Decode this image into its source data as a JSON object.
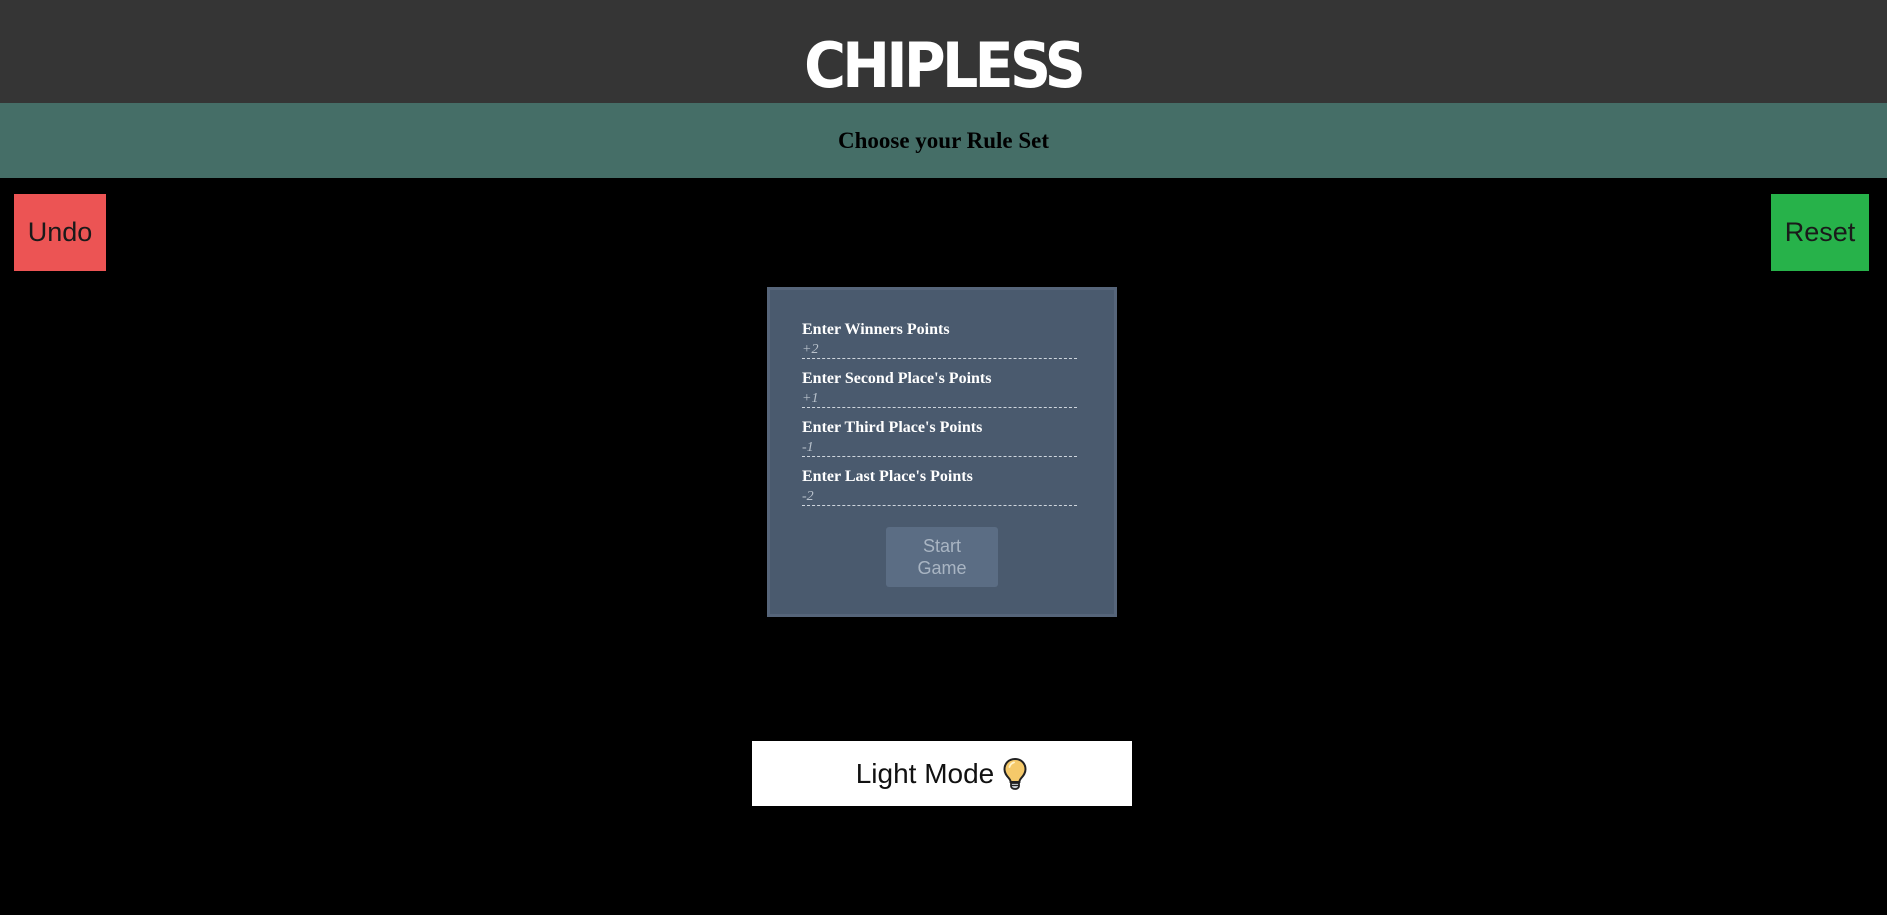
{
  "header": {
    "logo": "CHIPLESS",
    "subtitle": "Choose your Rule Set"
  },
  "actions": {
    "undo_label": "Undo",
    "reset_label": "Reset"
  },
  "ruleset": {
    "fields": [
      {
        "label": "Enter Winners Points",
        "placeholder": "+2",
        "value": ""
      },
      {
        "label": "Enter Second Place's Points",
        "placeholder": "+1",
        "value": ""
      },
      {
        "label": "Enter Third Place's Points",
        "placeholder": "-1",
        "value": ""
      },
      {
        "label": "Enter Last Place's Points",
        "placeholder": "-2",
        "value": ""
      }
    ],
    "start_label": "Start Game"
  },
  "theme": {
    "toggle_label": "Light Mode",
    "toggle_icon": "lightbulb-icon"
  },
  "colors": {
    "topbar": "#353535",
    "subbar": "#456e67",
    "undo": "#ec5454",
    "reset": "#27b24a",
    "panel": "#4a5a6e",
    "start_button": "#5b6d84",
    "bulb": "#f5c96a"
  }
}
